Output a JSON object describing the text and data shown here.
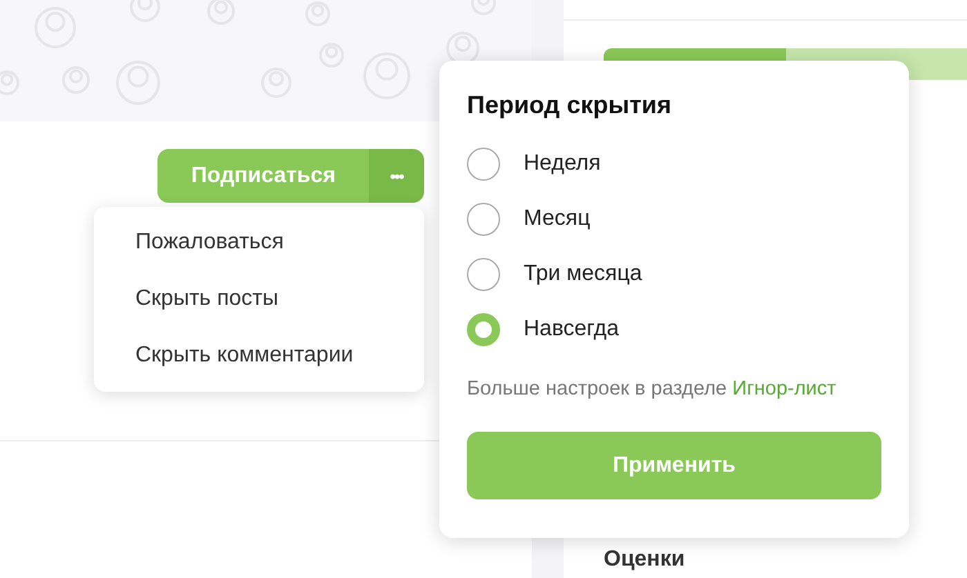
{
  "profile": {
    "subscribe_button": "Подписаться",
    "more_button": "•••"
  },
  "more_menu": {
    "items": [
      "Пожаловаться",
      "Скрыть посты",
      "Скрыть комментарии"
    ]
  },
  "progress": {
    "level": 0.5
  },
  "hide_period": {
    "title": "Период скрытия",
    "options": [
      {
        "label": "Неделя",
        "selected": false
      },
      {
        "label": "Месяц",
        "selected": false
      },
      {
        "label": "Три месяца",
        "selected": false
      },
      {
        "label": "Навсегда",
        "selected": true
      }
    ],
    "hint": "Больше настроек в разделе",
    "hint_link": "Игнор-лист",
    "apply_button": "Применить"
  },
  "sidebar": {
    "section_title": "Оценки"
  }
}
